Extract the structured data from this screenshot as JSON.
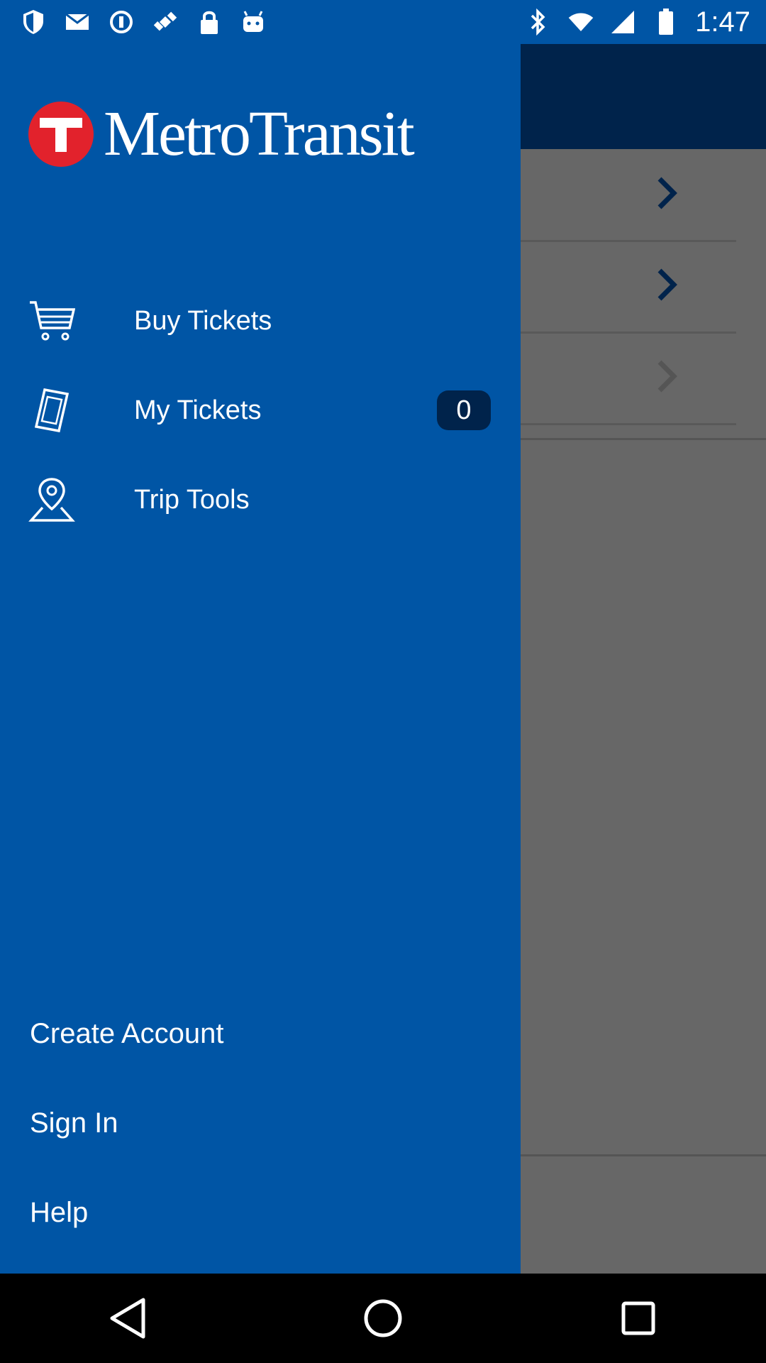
{
  "status_bar": {
    "time": "1:47",
    "left_icons": [
      "shield-icon",
      "mail-icon",
      "info-icon",
      "satellite-icon",
      "lock-icon",
      "android-icon"
    ],
    "right_icons": [
      "bluetooth-icon",
      "wifi-icon",
      "signal-icon",
      "battery-icon"
    ]
  },
  "drawer": {
    "logo_text": "MetroTransit",
    "menu": [
      {
        "label": "Buy Tickets",
        "icon": "cart-icon"
      },
      {
        "label": "My Tickets",
        "icon": "ticket-icon",
        "badge": "0"
      },
      {
        "label": "Trip Tools",
        "icon": "map-pin-icon"
      }
    ],
    "bottom": {
      "create_account": "Create Account",
      "sign_in": "Sign In",
      "help": "Help"
    }
  },
  "colors": {
    "drawer_bg": "#0055a5",
    "header_bg": "#00234b",
    "scrim": "#676767",
    "logo_red": "#e2222c"
  },
  "nav_bar": {
    "buttons": [
      "back-icon",
      "home-icon",
      "recents-icon"
    ]
  }
}
